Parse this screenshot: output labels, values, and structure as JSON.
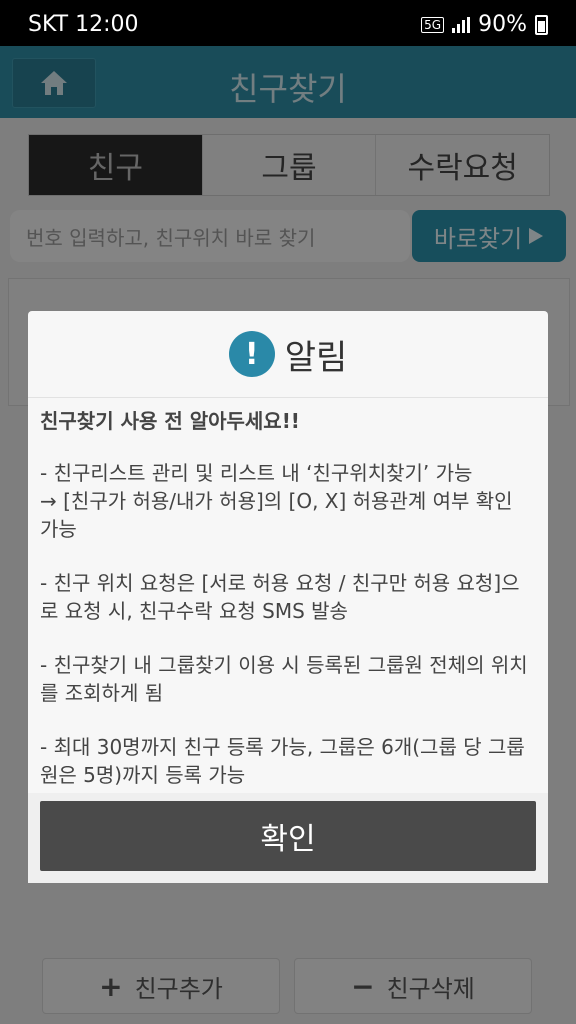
{
  "status": {
    "carrier": "SKT",
    "time": "12:00",
    "network": "5G",
    "battery": "90%"
  },
  "header": {
    "title": "친구찾기"
  },
  "tabs": [
    {
      "label": "친구"
    },
    {
      "label": "그룹"
    },
    {
      "label": "수락요청"
    }
  ],
  "search": {
    "placeholder": "번호 입력하고, 친구위치 바로 찾기",
    "button_label": "바로찾기"
  },
  "bottom": {
    "add_label": "친구추가",
    "delete_label": "친구삭제"
  },
  "dialog": {
    "title": "알림",
    "heading": "친구찾기 사용 전 알아두세요!!",
    "paragraphs": [
      " - 친구리스트 관리 및 리스트 내 ‘친구위치찾기’ 가능\n→ [친구가 허용/내가 허용]의 [O, X] 허용관계 여부 확인 가능",
      " - 친구 위치 요청은 [서로 허용 요청 / 친구만 허용 요청]으로 요청 시, 친구수락 요청 SMS 발송",
      " - 친구찾기 내 그룹찾기 이용 시 등록된 그룹원 전체의 위치를 조회하게 됨",
      " - 최대 30명까지 친구 등록 가능, 그룹은 6개(그룹 당 그룹원은 5명)까지 등록 가능"
    ],
    "confirm_label": "확인"
  }
}
